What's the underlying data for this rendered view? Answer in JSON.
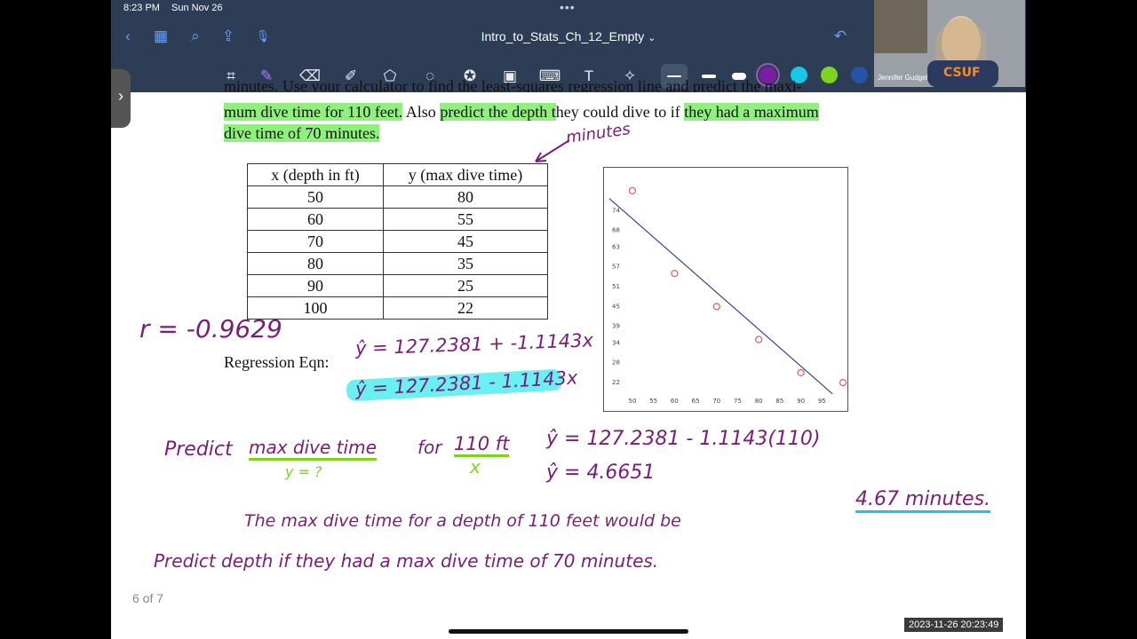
{
  "status": {
    "time": "8:23 PM",
    "date": "Sun Nov 26"
  },
  "header": {
    "title": "Intro_to_Stats_Ch_12_Empty",
    "title_chevron": "⌄"
  },
  "icons": {
    "back": "‹",
    "grid": "▦",
    "search": "⌕",
    "share": "⇪",
    "mic": "🎙",
    "undo": "↶",
    "toolbar": [
      "lasso-text-icon",
      "pen-icon",
      "eraser-icon",
      "highlighter-icon",
      "shapes-icon",
      "lasso-icon",
      "sticker-icon",
      "image-icon",
      "keyboard-icon",
      "text-icon",
      "laser-pointer-icon"
    ]
  },
  "colors": {
    "topbar": "#2c3d55",
    "swatches": [
      "#7b1fa2",
      "#18c6e6",
      "#7ed321",
      "#2653a8"
    ],
    "ink": "#7a1d7a",
    "highlight": "#8ff07c",
    "cyan_hl": "#6bf0f2"
  },
  "document": {
    "line1": "minutes. Use your calculator to find the least-squares regression line and predict the maxi-",
    "line2_a": "mum dive",
    "line2_b": " time for 110 feet.",
    "line2_c": " Also ",
    "line2_d": "predict the depth t",
    "line2_e": "hey could dive to if ",
    "line2_f": "they had a maximum",
    "line3": "dive time of 70 minutes.",
    "table": {
      "headers": [
        "x (depth in ft)",
        "y (max dive time)"
      ],
      "rows": [
        [
          "50",
          "80"
        ],
        [
          "60",
          "55"
        ],
        [
          "70",
          "45"
        ],
        [
          "80",
          "35"
        ],
        [
          "90",
          "25"
        ],
        [
          "100",
          "22"
        ]
      ]
    },
    "regression_label": "Regression Eqn:",
    "page_count": "6 of 7"
  },
  "handwriting": {
    "minutes_note": "minutes",
    "r_value": "r = -0.9629",
    "eqn1": "ŷ = 127.2381 + -1.1143x",
    "eqn2": "ŷ = 127.2381 - 1.1143x",
    "predict1_a": "Predict",
    "predict1_b": "max dive time",
    "predict1_c": "for",
    "predict1_d": "110 ft",
    "y_q": "y = ?",
    "x_mark": "x",
    "calc1": "ŷ = 127.2381 - 1.1143(110)",
    "calc2": "ŷ = 4.6651",
    "sentence_a": "The max dive time for a depth of 110 feet would be",
    "sentence_b": "4.67 minutes.",
    "predict2": "Predict depth if they had a max dive time of 70 minutes."
  },
  "chart_data": {
    "type": "scatter",
    "x": [
      50,
      60,
      70,
      80,
      90,
      100
    ],
    "y": [
      80,
      55,
      45,
      35,
      25,
      22
    ],
    "x_ticks": [
      "50",
      "55",
      "60",
      "65",
      "70",
      "75",
      "80",
      "85",
      "90",
      "95"
    ],
    "y_ticks": [
      "22",
      "28",
      "34",
      "39",
      "45",
      "51",
      "57",
      "63",
      "68",
      "74"
    ],
    "xlim": [
      46,
      100
    ],
    "ylim": [
      18,
      84
    ],
    "regression": {
      "slope": -1.1143,
      "intercept": 127.2381
    },
    "marker_color": "#e05c5c",
    "line_color": "#3f3fa3"
  },
  "webcam": {
    "name": "Jennifer Gudgel"
  },
  "timestamp": "2023-11-26  20:23:49"
}
